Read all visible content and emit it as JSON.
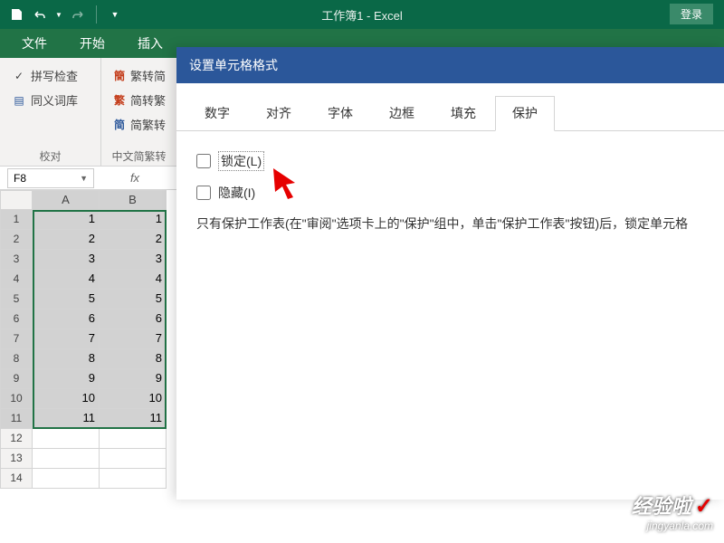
{
  "titlebar": {
    "app_title": "工作簿1 - Excel",
    "login": "登录"
  },
  "ribbon_tabs": [
    "文件",
    "开始",
    "插入"
  ],
  "ribbon": {
    "group1": {
      "spell_check": "拼写检查",
      "thesaurus": "同义词库",
      "label": "校对"
    },
    "group2": {
      "trad_simp_prefix1": "簡",
      "trad_simp1": "繁转简",
      "trad_simp_prefix2": "繁",
      "trad_simp2": "简转繁",
      "trad_simp_prefix3": "简",
      "trad_simp3": "简繁转",
      "label": "中文简繁转"
    }
  },
  "namebox": {
    "value": "F8"
  },
  "columns": [
    "A",
    "B"
  ],
  "rows": [
    {
      "n": "1",
      "a": "1",
      "b": "1"
    },
    {
      "n": "2",
      "a": "2",
      "b": "2"
    },
    {
      "n": "3",
      "a": "3",
      "b": "3"
    },
    {
      "n": "4",
      "a": "4",
      "b": "4"
    },
    {
      "n": "5",
      "a": "5",
      "b": "5"
    },
    {
      "n": "6",
      "a": "6",
      "b": "6"
    },
    {
      "n": "7",
      "a": "7",
      "b": "7"
    },
    {
      "n": "8",
      "a": "8",
      "b": "8"
    },
    {
      "n": "9",
      "a": "9",
      "b": "9"
    },
    {
      "n": "10",
      "a": "10",
      "b": "10"
    },
    {
      "n": "11",
      "a": "11",
      "b": "11"
    },
    {
      "n": "12",
      "a": "",
      "b": ""
    },
    {
      "n": "13",
      "a": "",
      "b": ""
    },
    {
      "n": "14",
      "a": "",
      "b": ""
    }
  ],
  "dialog": {
    "title": "设置单元格格式",
    "tabs": [
      "数字",
      "对齐",
      "字体",
      "边框",
      "填充",
      "保护"
    ],
    "active_tab": 5,
    "lock_label": "锁定(L)",
    "hide_label": "隐藏(I)",
    "description": "只有保护工作表(在\"审阅\"选项卡上的\"保护\"组中，单击\"保护工作表\"按钮)后，锁定单元格"
  },
  "watermark": {
    "big": "经验啦",
    "small": "jingyanla.com"
  }
}
